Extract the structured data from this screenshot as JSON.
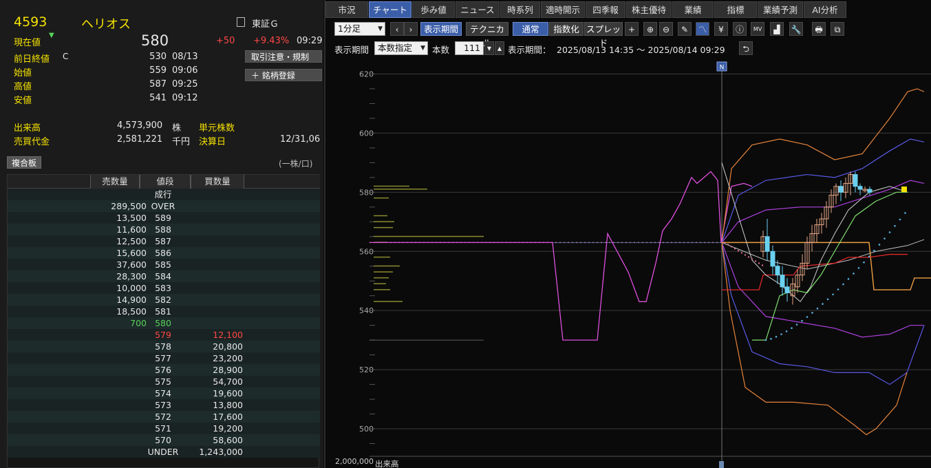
{
  "quote": {
    "code": "4593",
    "name": "ヘリオス",
    "market": "東証Ｇ",
    "current_label": "現在値",
    "price": "580",
    "change": "+50",
    "change_pct": "+9.43%",
    "time": "09:29",
    "rows": [
      {
        "label": "前日終値",
        "flag": "C",
        "value": "530",
        "time": "08/13"
      },
      {
        "label": "始値",
        "flag": "",
        "value": "559",
        "time": "09:06"
      },
      {
        "label": "高値",
        "flag": "",
        "value": "587",
        "time": "09:25"
      },
      {
        "label": "安値",
        "flag": "",
        "value": "541",
        "time": "09:12"
      }
    ],
    "volume_label": "出来高",
    "volume": "4,573,900",
    "volume_unit": "株",
    "turnover_label": "売買代金",
    "turnover": "2,581,221",
    "turnover_unit": "千円",
    "unit_shares_label": "単元株数",
    "settlement_label": "決算日",
    "settlement": "12/31,06",
    "notice_button": "取引注意・規制",
    "watchlist_button": "＋ 銘柄登録"
  },
  "board": {
    "tab_label": "複合板",
    "unit_note": "(一株/口)",
    "headers": {
      "sell": "売数量",
      "price": "値段",
      "buy": "買数量"
    },
    "rows": [
      {
        "sell": "",
        "price": "成行",
        "buy": "",
        "style": ""
      },
      {
        "sell": "289,500",
        "price": "OVER",
        "buy": "",
        "style": ""
      },
      {
        "sell": "13,500",
        "price": "589",
        "buy": "",
        "style": ""
      },
      {
        "sell": "11,600",
        "price": "588",
        "buy": "",
        "style": ""
      },
      {
        "sell": "12,500",
        "price": "587",
        "buy": "",
        "style": ""
      },
      {
        "sell": "15,600",
        "price": "586",
        "buy": "",
        "style": ""
      },
      {
        "sell": "37,600",
        "price": "585",
        "buy": "",
        "style": ""
      },
      {
        "sell": "28,300",
        "price": "584",
        "buy": "",
        "style": ""
      },
      {
        "sell": "10,000",
        "price": "583",
        "buy": "",
        "style": ""
      },
      {
        "sell": "14,900",
        "price": "582",
        "buy": "",
        "style": ""
      },
      {
        "sell": "18,500",
        "price": "581",
        "buy": "",
        "style": ""
      },
      {
        "sell": "700",
        "price": "580",
        "buy": "",
        "style": "green"
      },
      {
        "sell": "",
        "price": "579",
        "buy": "12,100",
        "style": "red"
      },
      {
        "sell": "",
        "price": "578",
        "buy": "20,800",
        "style": ""
      },
      {
        "sell": "",
        "price": "577",
        "buy": "23,200",
        "style": ""
      },
      {
        "sell": "",
        "price": "576",
        "buy": "28,900",
        "style": ""
      },
      {
        "sell": "",
        "price": "575",
        "buy": "54,700",
        "style": ""
      },
      {
        "sell": "",
        "price": "574",
        "buy": "19,600",
        "style": ""
      },
      {
        "sell": "",
        "price": "573",
        "buy": "13,800",
        "style": ""
      },
      {
        "sell": "",
        "price": "572",
        "buy": "17,600",
        "style": ""
      },
      {
        "sell": "",
        "price": "571",
        "buy": "19,200",
        "style": ""
      },
      {
        "sell": "",
        "price": "570",
        "buy": "58,600",
        "style": ""
      },
      {
        "sell": "",
        "price": "UNDER",
        "buy": "1,243,000",
        "style": ""
      }
    ]
  },
  "tabs": [
    "市況",
    "チャート",
    "歩み値",
    "ニュース",
    "時系列",
    "適時開示",
    "四季報",
    "株主優待",
    "業績",
    "指標",
    "業績予測",
    "AI分析"
  ],
  "active_tab": 1,
  "toolbar": {
    "interval": "1分足",
    "period_button": "表示期間",
    "technical_button": "テクニカル",
    "mode_normal": "通常",
    "mode_index": "指数化",
    "mode_spread": "スプレッド",
    "icons": [
      "crosshair-icon",
      "zoom-in-icon",
      "zoom-out-icon",
      "pencil-icon",
      "line-chart-icon",
      "yen-icon",
      "info-icon",
      "mv-icon",
      "volume-profile-icon",
      "wrench-icon",
      "print-icon",
      "popout-icon"
    ],
    "icon_glyphs": [
      "+",
      "⊕",
      "⊖",
      "✎",
      "〽",
      "¥",
      "ⓘ",
      "MV",
      "▟",
      "🔧",
      "🖶",
      "⧉"
    ]
  },
  "range_bar": {
    "label": "表示期間",
    "mode": "本数指定",
    "count_label": "本数",
    "count": "111",
    "range_label": "表示期間：",
    "range": "2025/08/13 14:35 ～ 2025/08/14 09:29"
  },
  "chart_data": {
    "type": "line",
    "ylim": [
      490,
      625
    ],
    "yticks": [
      500,
      520,
      540,
      560,
      580,
      600,
      620
    ],
    "marker_label": "N",
    "volume_label": "出来高",
    "volume_tick": "2,000,000",
    "colors": {
      "grid": "#3a3a3a",
      "magenta": "#e050e0",
      "blue": "#5a5ae8",
      "orange": "#e8843a",
      "violet": "#b040e0",
      "green": "#80e070",
      "red": "#e02828",
      "pink": "#e07090",
      "cyan": "#5ab0e0",
      "vp": "#8a8a30",
      "candle_up": "#e8a888",
      "candle_down": "#6ad0f0"
    }
  }
}
